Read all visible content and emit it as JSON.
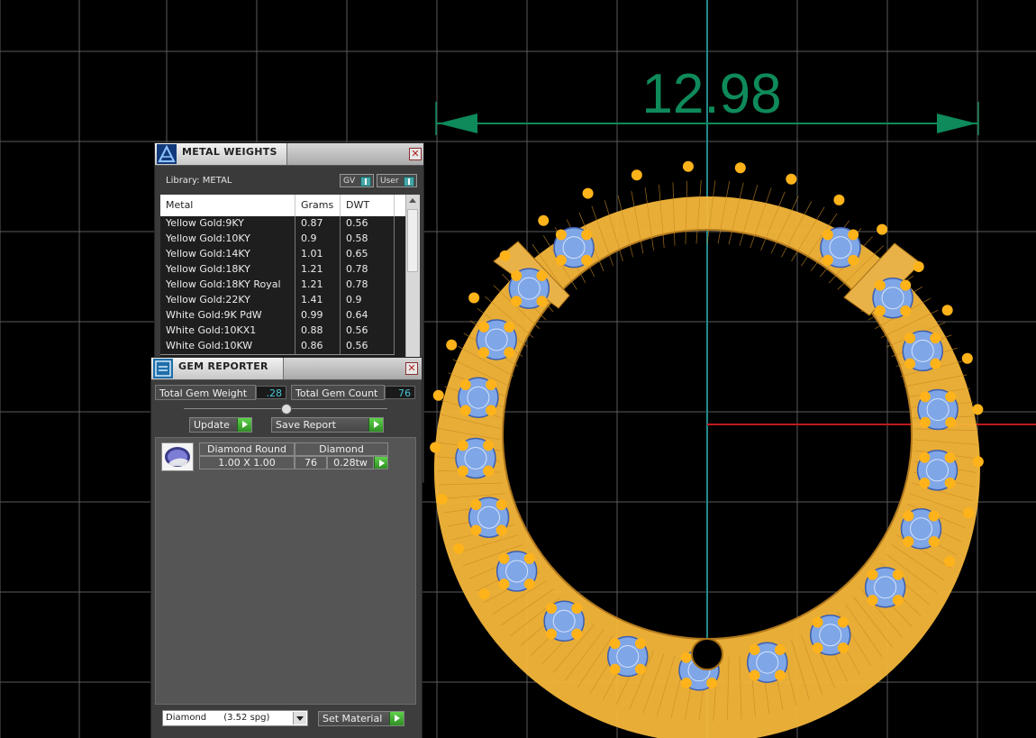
{
  "viewport": {
    "dimension_value": "12.98",
    "colors": {
      "background": "#000000",
      "grid": "#6e6e6e",
      "dimension": "#0f8a5a",
      "ring": "#f4b63a",
      "gems": "#7fa6e6",
      "axis_x": "#c01a1a",
      "axis_y": "#1f8a8a"
    }
  },
  "metal_weights": {
    "title": "METAL WEIGHTS",
    "library_label": "Library: METAL",
    "toggle_gv": "GV",
    "toggle_user": "User",
    "columns": [
      "Metal",
      "Grams",
      "DWT"
    ],
    "rows": [
      [
        "Yellow Gold:9KY",
        "0.87",
        "0.56"
      ],
      [
        "Yellow Gold:10KY",
        "0.9",
        "0.58"
      ],
      [
        "Yellow Gold:14KY",
        "1.01",
        "0.65"
      ],
      [
        "Yellow Gold:18KY",
        "1.21",
        "0.78"
      ],
      [
        "Yellow Gold:18KY Royal",
        "1.21",
        "0.78"
      ],
      [
        "Yellow Gold:22KY",
        "1.41",
        "0.9"
      ],
      [
        "White Gold:9K PdW",
        "0.99",
        "0.64"
      ],
      [
        "White Gold:10KX1",
        "0.88",
        "0.56"
      ],
      [
        "White Gold:10KW",
        "0.86",
        "0.56"
      ]
    ]
  },
  "gem_reporter": {
    "title": "GEM REPORTER",
    "total_weight_label": "Total Gem Weight",
    "total_weight_value": ".28",
    "total_count_label": "Total Gem Count",
    "total_count_value": "76",
    "update_label": "Update",
    "save_report_label": "Save Report",
    "gem": {
      "shape": "Diamond Round",
      "size": "1.00 X 1.00",
      "material": "Diamond",
      "count": "76",
      "weight": "0.28tw"
    },
    "material_select": "Diamond      (3.52 spg)",
    "set_material_label": "Set Material"
  }
}
